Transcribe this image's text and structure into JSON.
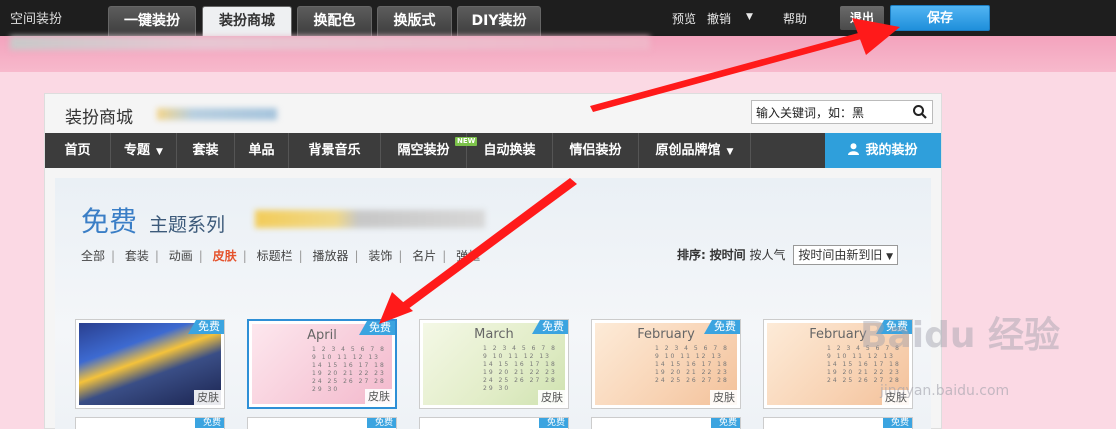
{
  "topbar": {
    "app_title": "空间装扮",
    "tabs": [
      "一键装扮",
      "装扮商城",
      "换配色",
      "换版式",
      "DIY装扮"
    ],
    "active_tab": "装扮商城",
    "links": [
      "预览",
      "撤销",
      "帮助"
    ],
    "exit_label": "退出",
    "save_label": "保存"
  },
  "panel": {
    "title": "装扮商城",
    "search": {
      "value": "输入关键词，如：黑"
    }
  },
  "nav": {
    "items": [
      {
        "label": "首页"
      },
      {
        "label": "专题"
      },
      {
        "label": "套装"
      },
      {
        "label": "单品"
      },
      {
        "label": "背景音乐"
      },
      {
        "label": "隔空装扮"
      },
      {
        "label": "自动换装"
      },
      {
        "label": "情侣装扮"
      },
      {
        "label": "原创品牌馆"
      }
    ],
    "new_badge": "NEW",
    "my_dress_label": "我的装扮"
  },
  "content": {
    "title_big": "免费",
    "title_small": "主题系列",
    "filters": [
      "全部",
      "套装",
      "动画",
      "皮肤",
      "标题栏",
      "播放器",
      "装饰",
      "名片",
      "弹框"
    ],
    "active_filter": "皮肤",
    "sort": {
      "label": "排序:",
      "by_time": "按时间",
      "by_popularity": "按人气",
      "select_value": "按时间由新到旧"
    },
    "cards": [
      {
        "free": "免费",
        "type": "皮肤",
        "month": ""
      },
      {
        "free": "免费",
        "type": "皮肤",
        "month": "April"
      },
      {
        "free": "免费",
        "type": "皮肤",
        "month": "March"
      },
      {
        "free": "免费",
        "type": "皮肤",
        "month": "February"
      },
      {
        "free": "免费",
        "type": "皮肤",
        "month": "February"
      }
    ],
    "row2_tag": "免费"
  },
  "watermark": {
    "brand": "Baidu 经验",
    "url": "jingyan.baidu.com"
  },
  "colors": {
    "accent_blue": "#2f9fdb",
    "arrow_red": "#ff1a1a",
    "active_filter": "#e5532d"
  }
}
